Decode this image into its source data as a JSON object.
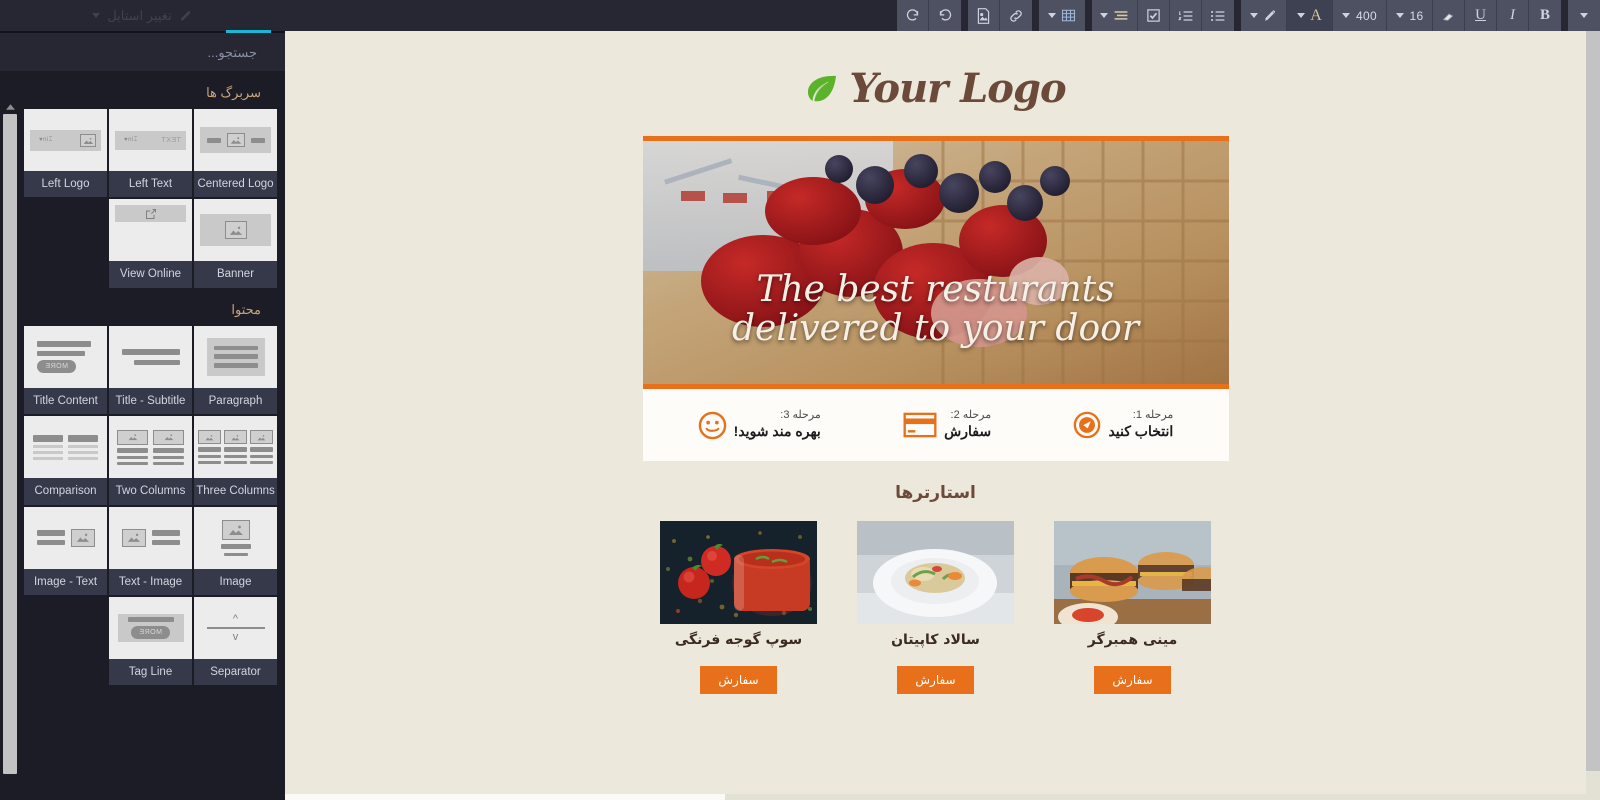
{
  "toolbar": {
    "groups": [
      {
        "buttons": [
          {
            "name": "redo-icon",
            "glyph": "redo",
            "label": ""
          },
          {
            "name": "undo-icon",
            "glyph": "undo",
            "label": ""
          }
        ]
      },
      {
        "buttons": [
          {
            "name": "insert-image-icon",
            "glyph": "image-doc",
            "label": ""
          },
          {
            "name": "insert-link-icon",
            "glyph": "link",
            "label": ""
          }
        ]
      },
      {
        "buttons": [
          {
            "name": "table-icon",
            "glyph": "table",
            "label": "",
            "caret": true
          }
        ]
      },
      {
        "buttons": [
          {
            "name": "align-icon",
            "glyph": "align",
            "label": "",
            "caret": true
          },
          {
            "name": "checkbox-icon",
            "glyph": "checkbox",
            "label": ""
          },
          {
            "name": "ordered-list-icon",
            "glyph": "ol",
            "label": ""
          },
          {
            "name": "unordered-list-icon",
            "glyph": "ul",
            "label": ""
          }
        ]
      },
      {
        "buttons": [
          {
            "name": "text-color-icon",
            "glyph": "brush",
            "label": "",
            "caret": true
          },
          {
            "name": "font-color-icon",
            "glyph": "letter-a",
            "label": "",
            "caret": true,
            "active": true
          },
          {
            "name": "font-weight-selector",
            "glyph": "text",
            "label": "400",
            "caret": true
          },
          {
            "name": "font-size-selector",
            "glyph": "text",
            "label": "16",
            "caret": true
          },
          {
            "name": "clear-format-icon",
            "glyph": "eraser",
            "label": ""
          },
          {
            "name": "underline-button",
            "glyph": "underline",
            "label": ""
          },
          {
            "name": "italic-button",
            "glyph": "italic",
            "label": ""
          },
          {
            "name": "bold-button",
            "glyph": "bold",
            "label": ""
          }
        ]
      },
      {
        "buttons": [
          {
            "name": "more-options-icon",
            "glyph": "caret-only",
            "label": ""
          }
        ]
      }
    ]
  },
  "sidebar": {
    "tab_label": "تغییر استایل",
    "search_placeholder": "جستجو...",
    "sections": [
      {
        "title": "سربرگ ها",
        "tiles": [
          {
            "name": "Centered Logo",
            "thumb": "centered-logo"
          },
          {
            "name": "Left Text",
            "thumb": "left-text"
          },
          {
            "name": "Left Logo",
            "thumb": "left-logo"
          },
          {
            "name": "",
            "thumb": "empty"
          },
          {
            "name": "View Online",
            "thumb": "view-online"
          },
          {
            "name": "Banner",
            "thumb": "banner"
          }
        ]
      },
      {
        "title": "محتوا",
        "tiles": [
          {
            "name": "Paragraph",
            "thumb": "paragraph"
          },
          {
            "name": "Title - Subtitle",
            "thumb": "title-subtitle"
          },
          {
            "name": "Title Content",
            "thumb": "title-content"
          },
          {
            "name": "Three Columns",
            "thumb": "three-columns"
          },
          {
            "name": "Two Columns",
            "thumb": "two-columns"
          },
          {
            "name": "Comparison",
            "thumb": "comparison"
          },
          {
            "name": "Image",
            "thumb": "image"
          },
          {
            "name": "Text - Image",
            "thumb": "text-image"
          },
          {
            "name": "Image - Text",
            "thumb": "image-text"
          },
          {
            "name": "",
            "thumb": "empty"
          },
          {
            "name": "Tag Line",
            "thumb": "tag-line"
          },
          {
            "name": "Separator",
            "thumb": "separator"
          }
        ]
      }
    ]
  },
  "email": {
    "logo_text": "Your Logo",
    "hero_line1": "The best resturants",
    "hero_line2": "delivered to your door",
    "steps": [
      {
        "sub": "مرحله 1:",
        "main": "انتخاب کنید",
        "icon": "compass-icon"
      },
      {
        "sub": "مرحله 2:",
        "main": "سفارش",
        "icon": "credit-card-icon"
      },
      {
        "sub": "مرحله 3:",
        "main": "بهره مند شوید!",
        "icon": "smiley-icon"
      }
    ],
    "starters_title": "استارترها",
    "cards": [
      {
        "name": "مینی همبرگر",
        "button": "سفارش",
        "image": "burger-sliders"
      },
      {
        "name": "سالاد کاپیتان",
        "button": "سفارش",
        "image": "captain-salad"
      },
      {
        "name": "سوپ گوجه فرنگی",
        "button": "سفارش",
        "image": "tomato-soup"
      }
    ]
  },
  "colors": {
    "accent_orange": "#e8701a",
    "canvas_bg": "#ece8dc",
    "panel_bg": "#1c1c27",
    "toolbar_bg": "#272733",
    "tab_active": "#16b8d4",
    "logo_brown": "#6b4a3a",
    "leaf_green": "#5cb32b"
  }
}
